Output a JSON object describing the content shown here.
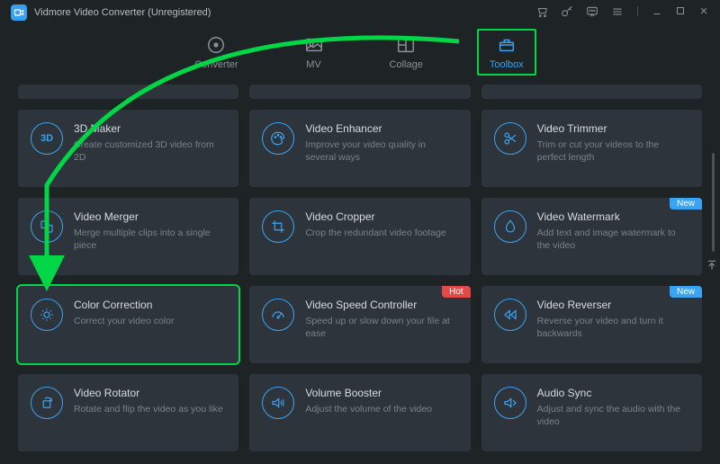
{
  "window": {
    "title": "Vidmore Video Converter (Unregistered)"
  },
  "tabs": {
    "converter": "Converter",
    "mv": "MV",
    "collage": "Collage",
    "toolbox": "Toolbox"
  },
  "tools": {
    "maker3d": {
      "title": "3D Maker",
      "desc": "Create customized 3D video from 2D"
    },
    "enhancer": {
      "title": "Video Enhancer",
      "desc": "Improve your video quality in several ways"
    },
    "trimmer": {
      "title": "Video Trimmer",
      "desc": "Trim or cut your videos to the perfect length"
    },
    "merger": {
      "title": "Video Merger",
      "desc": "Merge multiple clips into a single piece"
    },
    "cropper": {
      "title": "Video Cropper",
      "desc": "Crop the redundant video footage"
    },
    "watermark": {
      "title": "Video Watermark",
      "desc": "Add text and image watermark to the video",
      "badge": "New"
    },
    "color": {
      "title": "Color Correction",
      "desc": "Correct your video color"
    },
    "speed": {
      "title": "Video Speed Controller",
      "desc": "Speed up or slow down your file at ease",
      "badge": "Hot"
    },
    "reverser": {
      "title": "Video Reverser",
      "desc": "Reverse your video and turn it backwards",
      "badge": "New"
    },
    "rotator": {
      "title": "Video Rotator",
      "desc": "Rotate and flip the video as you like"
    },
    "volume": {
      "title": "Volume Booster",
      "desc": "Adjust the volume of the video"
    },
    "audiosync": {
      "title": "Audio Sync",
      "desc": "Adjust and sync the audio with the video"
    }
  }
}
